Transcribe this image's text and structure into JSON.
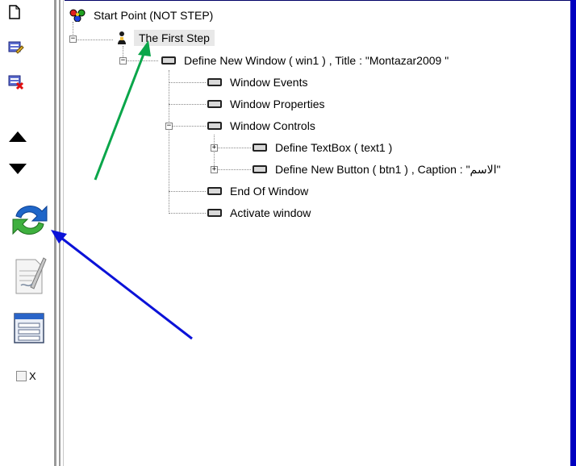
{
  "toolbar": {
    "items": [
      {
        "icon": "new-document-icon"
      },
      {
        "icon": "edit-properties-icon"
      },
      {
        "icon": "delete-item-icon"
      },
      {
        "icon": "move-up-arrow-icon"
      },
      {
        "icon": "move-down-arrow-icon"
      },
      {
        "icon": "refresh-icon"
      },
      {
        "icon": "edit-notes-icon"
      },
      {
        "icon": "form-window-icon"
      }
    ],
    "checkbox_label": "X",
    "checkbox_checked": false
  },
  "tree": {
    "root": "Start Point (NOT STEP)",
    "step": "The First Step",
    "window": "Define New Window  ( win1 ) , Title : \"Montazar2009  \"",
    "events": "Window Events",
    "properties": "Window Properties",
    "controls": "Window Controls",
    "textbox": "Define TextBox  ( text1  )",
    "button": "Define New Button ( btn1 ) , Caption : \"الاسم\"",
    "end": "End Of Window",
    "activate": "Activate window"
  },
  "colors": {
    "green_arrow": "#0aa64a",
    "blue_arrow": "#0b12d8",
    "selection": "#e8e8e8",
    "panel_edge": "#0000c0"
  }
}
